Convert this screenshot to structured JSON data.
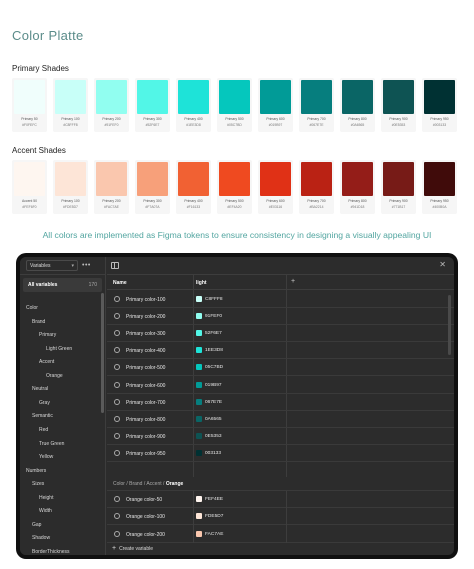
{
  "page_title": "Color Platte",
  "primary": {
    "label": "Primary Shades",
    "swatches": [
      {
        "name": "Primary 50",
        "hex": "#F0FEFC",
        "color": "#F0FEFC"
      },
      {
        "name": "Primary 100",
        "hex": "#C8FFF8",
        "color": "#C8FFF8"
      },
      {
        "name": "Primary 200",
        "hex": "#91FEF0",
        "color": "#91FEF0"
      },
      {
        "name": "Primary 300",
        "hex": "#52F6E7",
        "color": "#52F6E7"
      },
      {
        "name": "Primary 400",
        "hex": "#1EE3D8",
        "color": "#1EE3D8"
      },
      {
        "name": "Primary 500",
        "hex": "#05C7BD",
        "color": "#05C7BD"
      },
      {
        "name": "Primary 600",
        "hex": "#019B97",
        "color": "#019B97"
      },
      {
        "name": "Primary 700",
        "hex": "#067E7E",
        "color": "#067E7E"
      },
      {
        "name": "Primary 800",
        "hex": "#0A6565",
        "color": "#0A6565"
      },
      {
        "name": "Primary 900",
        "hex": "#0E5353",
        "color": "#0E5353"
      },
      {
        "name": "Primary 950",
        "hex": "#003133",
        "color": "#003133"
      }
    ]
  },
  "accent": {
    "label": "Accent Shades",
    "swatches": [
      {
        "name": "Accent 50",
        "hex": "#FEF6F0",
        "color": "#FEF6F0"
      },
      {
        "name": "Primary 100",
        "hex": "#FDE5D7",
        "color": "#FDE5D7"
      },
      {
        "name": "Primary 200",
        "hex": "#FAC7AE",
        "color": "#FAC7AE"
      },
      {
        "name": "Primary 300",
        "hex": "#F7A07A",
        "color": "#F7A07A"
      },
      {
        "name": "Primary 400",
        "hex": "#F16133",
        "color": "#F16133"
      },
      {
        "name": "Primary 500",
        "hex": "#EF4A20",
        "color": "#EF4A20"
      },
      {
        "name": "Primary 600",
        "hex": "#E03116",
        "color": "#E03116"
      },
      {
        "name": "Primary 700",
        "hex": "#BA2214",
        "color": "#BA2214"
      },
      {
        "name": "Primary 800",
        "hex": "#941D18",
        "color": "#941D18"
      },
      {
        "name": "Primary 900",
        "hex": "#771B17",
        "color": "#771B17"
      },
      {
        "name": "Primary 950",
        "hex": "#400B0A",
        "color": "#400B0A"
      }
    ]
  },
  "caption": "All colors are implemented as Figma tokens to ensure consistency in designing a visually appealing UI",
  "figma": {
    "collection_select": "Variables",
    "more_label": "•••",
    "all_variables": "All variables",
    "all_count": "170",
    "tree": [
      {
        "label": "Color",
        "indent": 0
      },
      {
        "label": "Brand",
        "indent": 1
      },
      {
        "label": "Primary",
        "indent": 2
      },
      {
        "label": "Light Green",
        "indent": 3
      },
      {
        "label": "Accent",
        "indent": 2
      },
      {
        "label": "Orange",
        "indent": 3
      },
      {
        "label": "Neutral",
        "indent": 1
      },
      {
        "label": "Gray",
        "indent": 2
      },
      {
        "label": "Semantic",
        "indent": 1
      },
      {
        "label": "Red",
        "indent": 2
      },
      {
        "label": "True Green",
        "indent": 2
      },
      {
        "label": "Yellow",
        "indent": 2
      },
      {
        "label": "Numbers",
        "indent": 0
      },
      {
        "label": "Sizes",
        "indent": 1
      },
      {
        "label": "Height",
        "indent": 2
      },
      {
        "label": "Width",
        "indent": 2
      },
      {
        "label": "Gap",
        "indent": 1
      },
      {
        "label": "Shadow",
        "indent": 1
      },
      {
        "label": "BorderThickness",
        "indent": 1
      }
    ],
    "col_name": "Name",
    "col_mode": "light",
    "add_col": "+",
    "close": "✕",
    "rows": [
      {
        "name": "Primary color-100",
        "hex": "C8FFF8",
        "color": "#C8FFF8"
      },
      {
        "name": "Primary color-200",
        "hex": "91FEF0",
        "color": "#91FEF0"
      },
      {
        "name": "Primary color-300",
        "hex": "52F6E7",
        "color": "#52F6E7"
      },
      {
        "name": "Primary color-400",
        "hex": "1EE3D8",
        "color": "#1EE3D8"
      },
      {
        "name": "Primary color-500",
        "hex": "05C7BD",
        "color": "#05C7BD"
      },
      {
        "name": "Primary color-600",
        "hex": "019B97",
        "color": "#019B97"
      },
      {
        "name": "Primary color-700",
        "hex": "067E7E",
        "color": "#067E7E"
      },
      {
        "name": "Primary color-800",
        "hex": "0A6565",
        "color": "#0A6565"
      },
      {
        "name": "Primary color-900",
        "hex": "0E5353",
        "color": "#0E5353"
      },
      {
        "name": "Primary color-950",
        "hex": "003133",
        "color": "#003133"
      }
    ],
    "group_path": "Color / Brand / Accent / ",
    "group_current": "Orange",
    "orange_rows": [
      {
        "name": "Orange color-50",
        "hex": "FEF4EE",
        "color": "#FEF4EE"
      },
      {
        "name": "Orange color-100",
        "hex": "FDE5D7",
        "color": "#FDE5D7"
      },
      {
        "name": "Orange color-200",
        "hex": "FAC7AE",
        "color": "#FAC7AE"
      }
    ],
    "create_label": "Create variable",
    "create_plus": "+"
  }
}
